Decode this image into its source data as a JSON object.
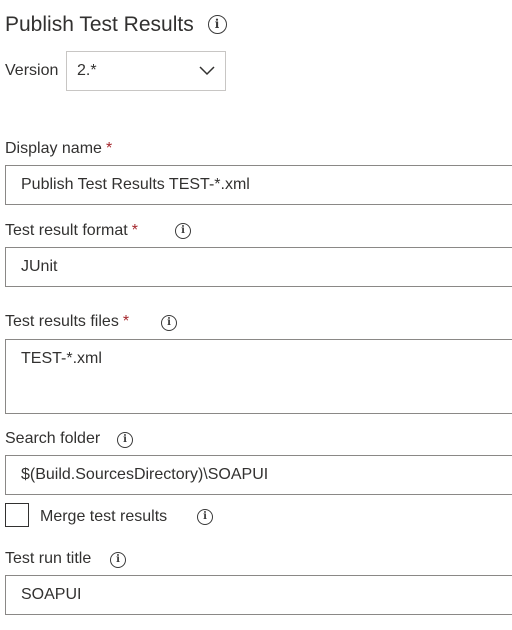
{
  "header": {
    "title": "Publish Test Results",
    "info_icon": "info-circle-icon"
  },
  "version": {
    "label": "Version",
    "selected": "2.*",
    "chevron_icon": "chevron-down-icon"
  },
  "display_name": {
    "label": "Display name",
    "required_mark": "*",
    "value": "Publish Test Results TEST-*.xml"
  },
  "test_result_format": {
    "label": "Test result format",
    "required_mark": "*",
    "value": "JUnit",
    "info_icon": "info-circle-icon"
  },
  "test_results_files": {
    "label": "Test results files",
    "required_mark": "*",
    "value": "TEST-*.xml",
    "info_icon": "info-circle-icon"
  },
  "search_folder": {
    "label": "Search folder",
    "value": "$(Build.SourcesDirectory)\\SOAPUI",
    "info_icon": "info-circle-icon"
  },
  "merge_test_results": {
    "label": "Merge test results",
    "checked": false,
    "info_icon": "info-circle-icon"
  },
  "test_run_title": {
    "label": "Test run title",
    "value": "SOAPUI",
    "info_icon": "info-circle-icon"
  },
  "colors": {
    "text": "#323130",
    "required": "#a4262c",
    "field_border": "#8a8886",
    "select_border": "#c8c6c4",
    "background": "#ffffff"
  }
}
